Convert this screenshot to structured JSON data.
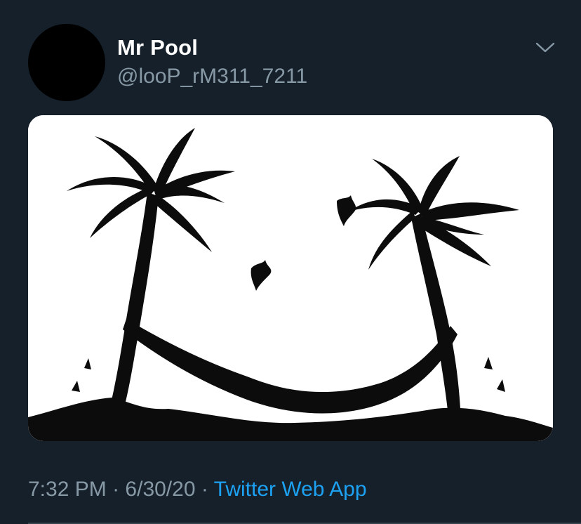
{
  "tweet": {
    "author": {
      "display_name": "Mr Pool",
      "handle": "@looP_rM311_7211"
    },
    "timestamp": {
      "time": "7:32 PM",
      "date": "6/30/20"
    },
    "separator": "·",
    "source": "Twitter Web App",
    "menu_icon": "chevron-down-icon",
    "media_icon": "palm-trees-hammock-smiley-image"
  },
  "colors": {
    "background": "#15202b",
    "text_primary": "#ffffff",
    "text_secondary": "#8899a6",
    "link": "#1da1f2"
  }
}
